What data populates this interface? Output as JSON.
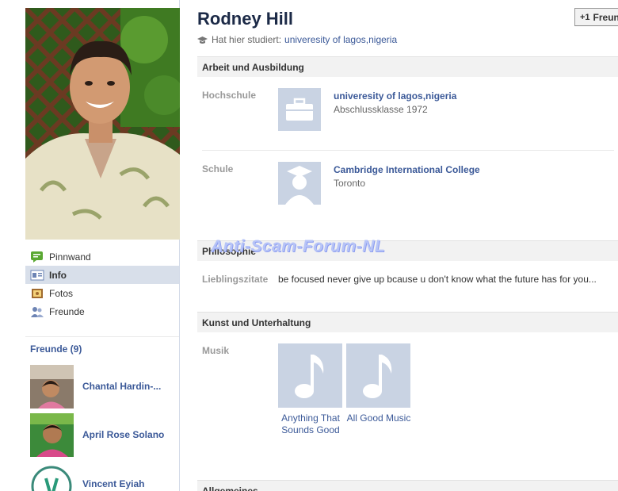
{
  "profile": {
    "name": "Rodney Hill",
    "studied_prefix": "Hat hier studiert:",
    "studied_value": "univeresity of lagos,nigeria",
    "friend_button_label": "Freun"
  },
  "nav": {
    "items": [
      {
        "label": "Pinnwand",
        "icon": "wall-icon"
      },
      {
        "label": "Info",
        "icon": "info-icon",
        "active": true
      },
      {
        "label": "Fotos",
        "icon": "photos-icon"
      },
      {
        "label": "Freunde",
        "icon": "friends-icon"
      }
    ]
  },
  "friends": {
    "title": "Freunde (9)",
    "list": [
      {
        "name": "Chantal Hardin-..."
      },
      {
        "name": "April Rose Solano"
      },
      {
        "name": "Vincent Eyiah"
      }
    ]
  },
  "sections": {
    "work": {
      "title": "Arbeit und Ausbildung",
      "hochschule_label": "Hochschule",
      "hochschule_name": "univeresity of lagos,nigeria",
      "hochschule_sub": "Abschlussklasse 1972",
      "schule_label": "Schule",
      "schule_name": "Cambridge International College",
      "schule_sub": "Toronto"
    },
    "philosophy": {
      "title": "Philosophie",
      "quotes_label": "Lieblingszitate",
      "quotes_value": "be focused never give up bcause u don't know what the future has for you..."
    },
    "entertainment": {
      "title": "Kunst und Unterhaltung",
      "music_label": "Musik",
      "music": [
        {
          "line1": "Anything That",
          "line2": "Sounds Good"
        },
        {
          "line1": "All Good Music",
          "line2": ""
        }
      ]
    },
    "general": {
      "title": "Allgemeines"
    }
  },
  "watermark": "Anti-Scam-Forum-NL",
  "colors": {
    "link": "#3b5998",
    "nav_active_bg": "#d8dfea",
    "section_bg": "#f2f2f2",
    "thumb_bg": "#c9d3e3"
  }
}
